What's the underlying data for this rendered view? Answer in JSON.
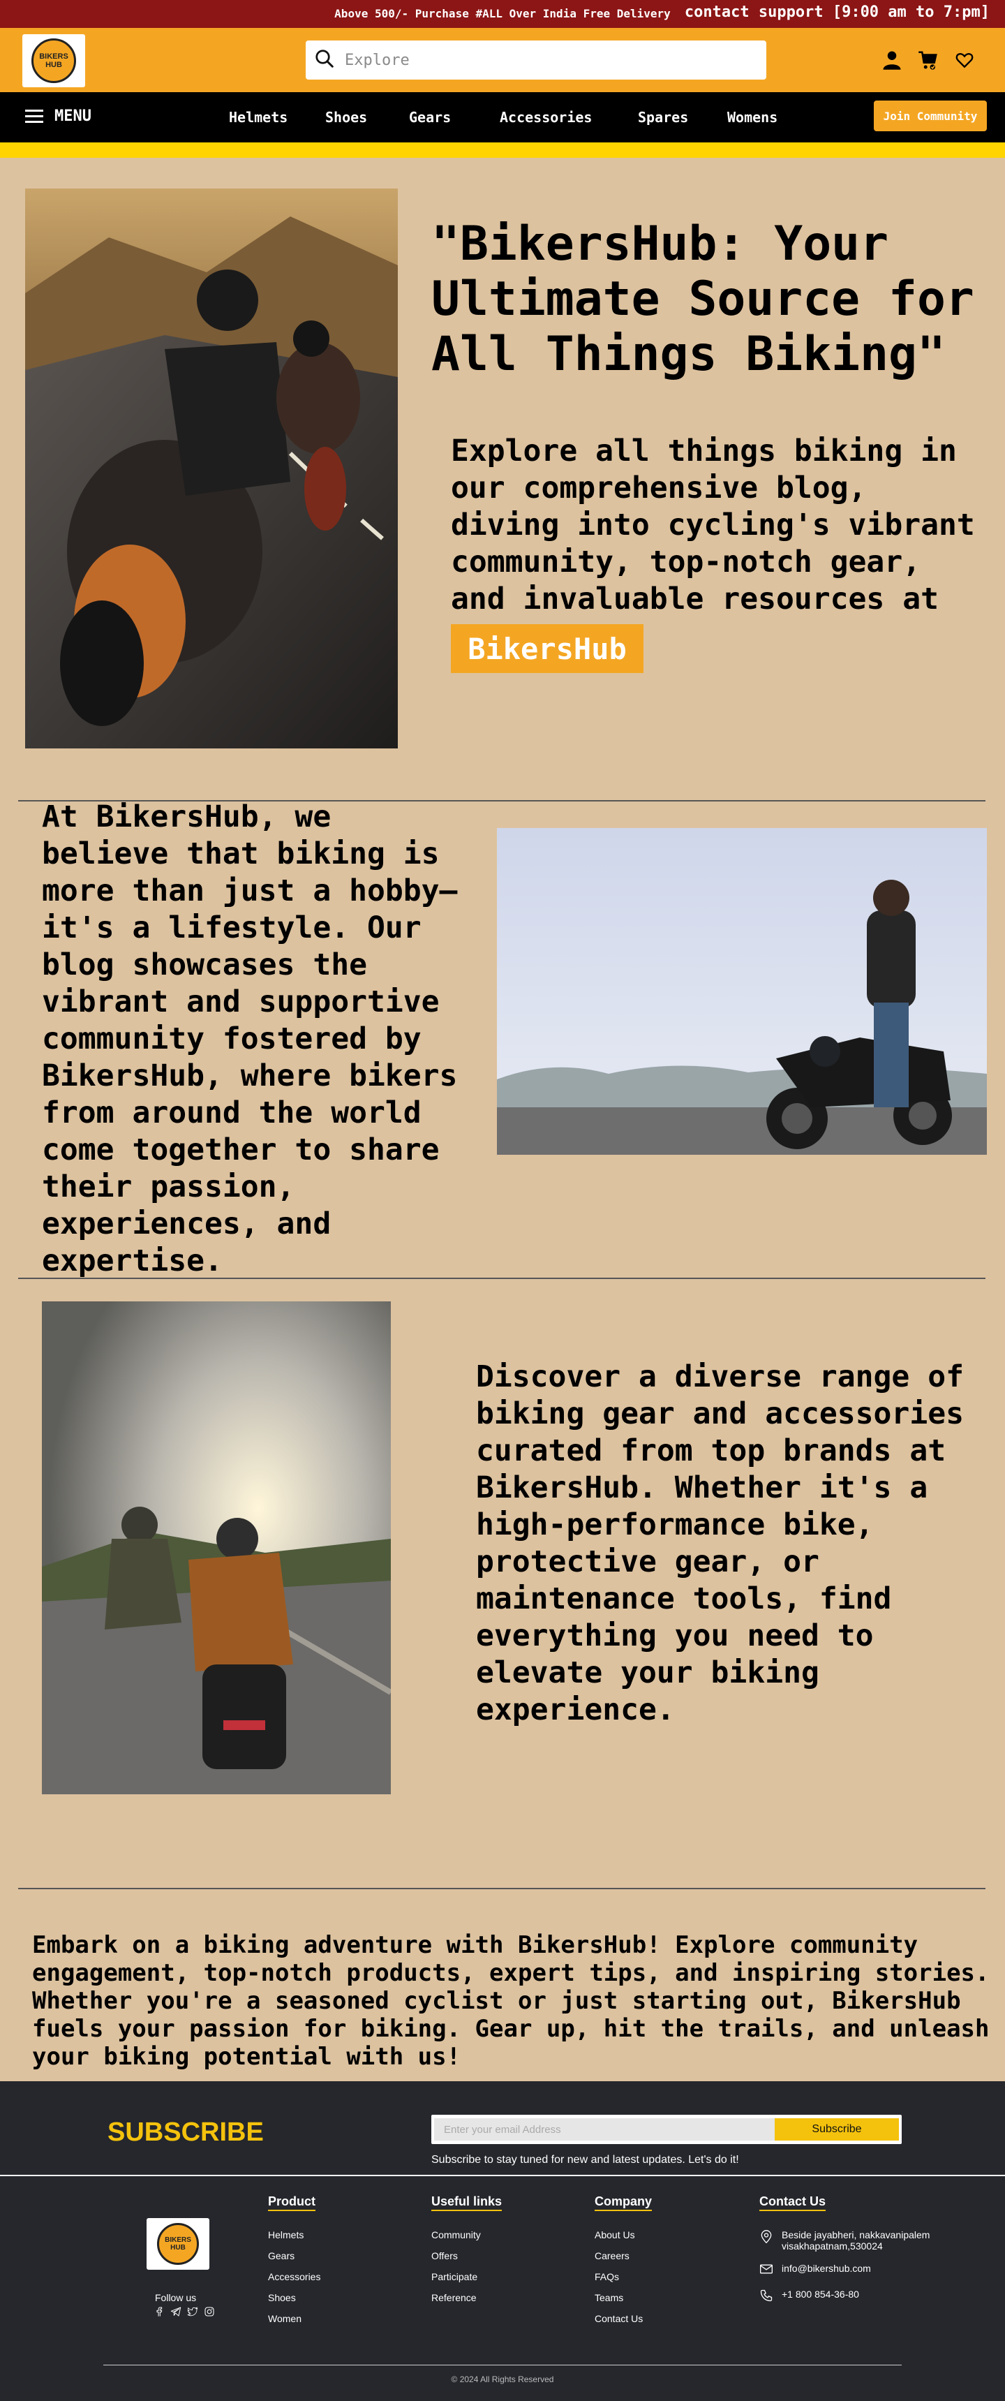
{
  "topbar": {
    "promo": "Above 500/- Purchase  #ALL Over India Free Delivery",
    "support": "contact support [9:00 am to 7:pm]"
  },
  "header": {
    "logo_text": "BIKERS HUB",
    "search_placeholder": "Explore",
    "icons": [
      "user-icon",
      "cart-icon",
      "heart-icon"
    ]
  },
  "nav": {
    "menu_label": "MENU",
    "items": [
      "Helmets",
      "Shoes",
      "Gears",
      "Accessories",
      "Spares",
      "Womens"
    ],
    "join_label": "Join Community"
  },
  "sections": {
    "s1_title": "\"BikersHub: Your Ultimate Source for All Things Biking\"",
    "s1_text": "Explore all things biking in our comprehensive blog, diving into cycling's vibrant community, top-notch gear, and invaluable resources at",
    "s1_badge": "BikersHub",
    "s2_text": "At BikersHub, we believe that biking is more than just a hobby—it's a lifestyle. Our blog showcases the vibrant and supportive community fostered by BikersHub, where bikers from around the world come together to share their passion, experiences, and expertise.",
    "s3_text": "Discover a diverse range of biking gear and accessories curated from top brands at BikersHub. Whether it's a high-performance bike, protective gear, or maintenance tools, find everything you need to elevate your biking experience.",
    "s4_text": "Embark on a biking adventure with BikersHub! Explore community engagement, top-notch products, expert tips, and inspiring stories. Whether you're a seasoned cyclist or just starting out, BikersHub fuels your passion for biking. Gear up, hit the trails, and unleash your biking potential with us!"
  },
  "subscribe": {
    "title": "SUBSCRIBE",
    "placeholder": "Enter your email Address",
    "button": "Subscribe",
    "note": "Subscribe to stay tuned for new and latest updates. Let's do it!"
  },
  "footer": {
    "logo_text": "BIKERS HUB",
    "follow": "Follow us",
    "product": {
      "title": "Product",
      "links": [
        "Helmets",
        "Gears",
        "Accessories",
        "Shoes",
        "Women"
      ]
    },
    "useful": {
      "title": "Useful links",
      "links": [
        "Community",
        "Offers",
        "Participate",
        "Reference"
      ]
    },
    "company": {
      "title": "Company",
      "links": [
        "About Us",
        "Careers",
        "FAQs",
        "Teams",
        "Contact Us"
      ]
    },
    "contact": {
      "title": "Contact Us",
      "address_line1": "Beside jayabheri, nakkavanipalem",
      "address_line2": "visakhapatnam,530024",
      "email": "info@bikershub.com",
      "phone": "+1 800 854-36-80"
    },
    "copyright": "© 2024 All Rights Reserved"
  },
  "colors": {
    "topbar": "#8C1515",
    "header": "#F4A623",
    "accent": "#F4C20D",
    "page_bg": "#DDC29F",
    "footer_bg": "#25272C"
  }
}
